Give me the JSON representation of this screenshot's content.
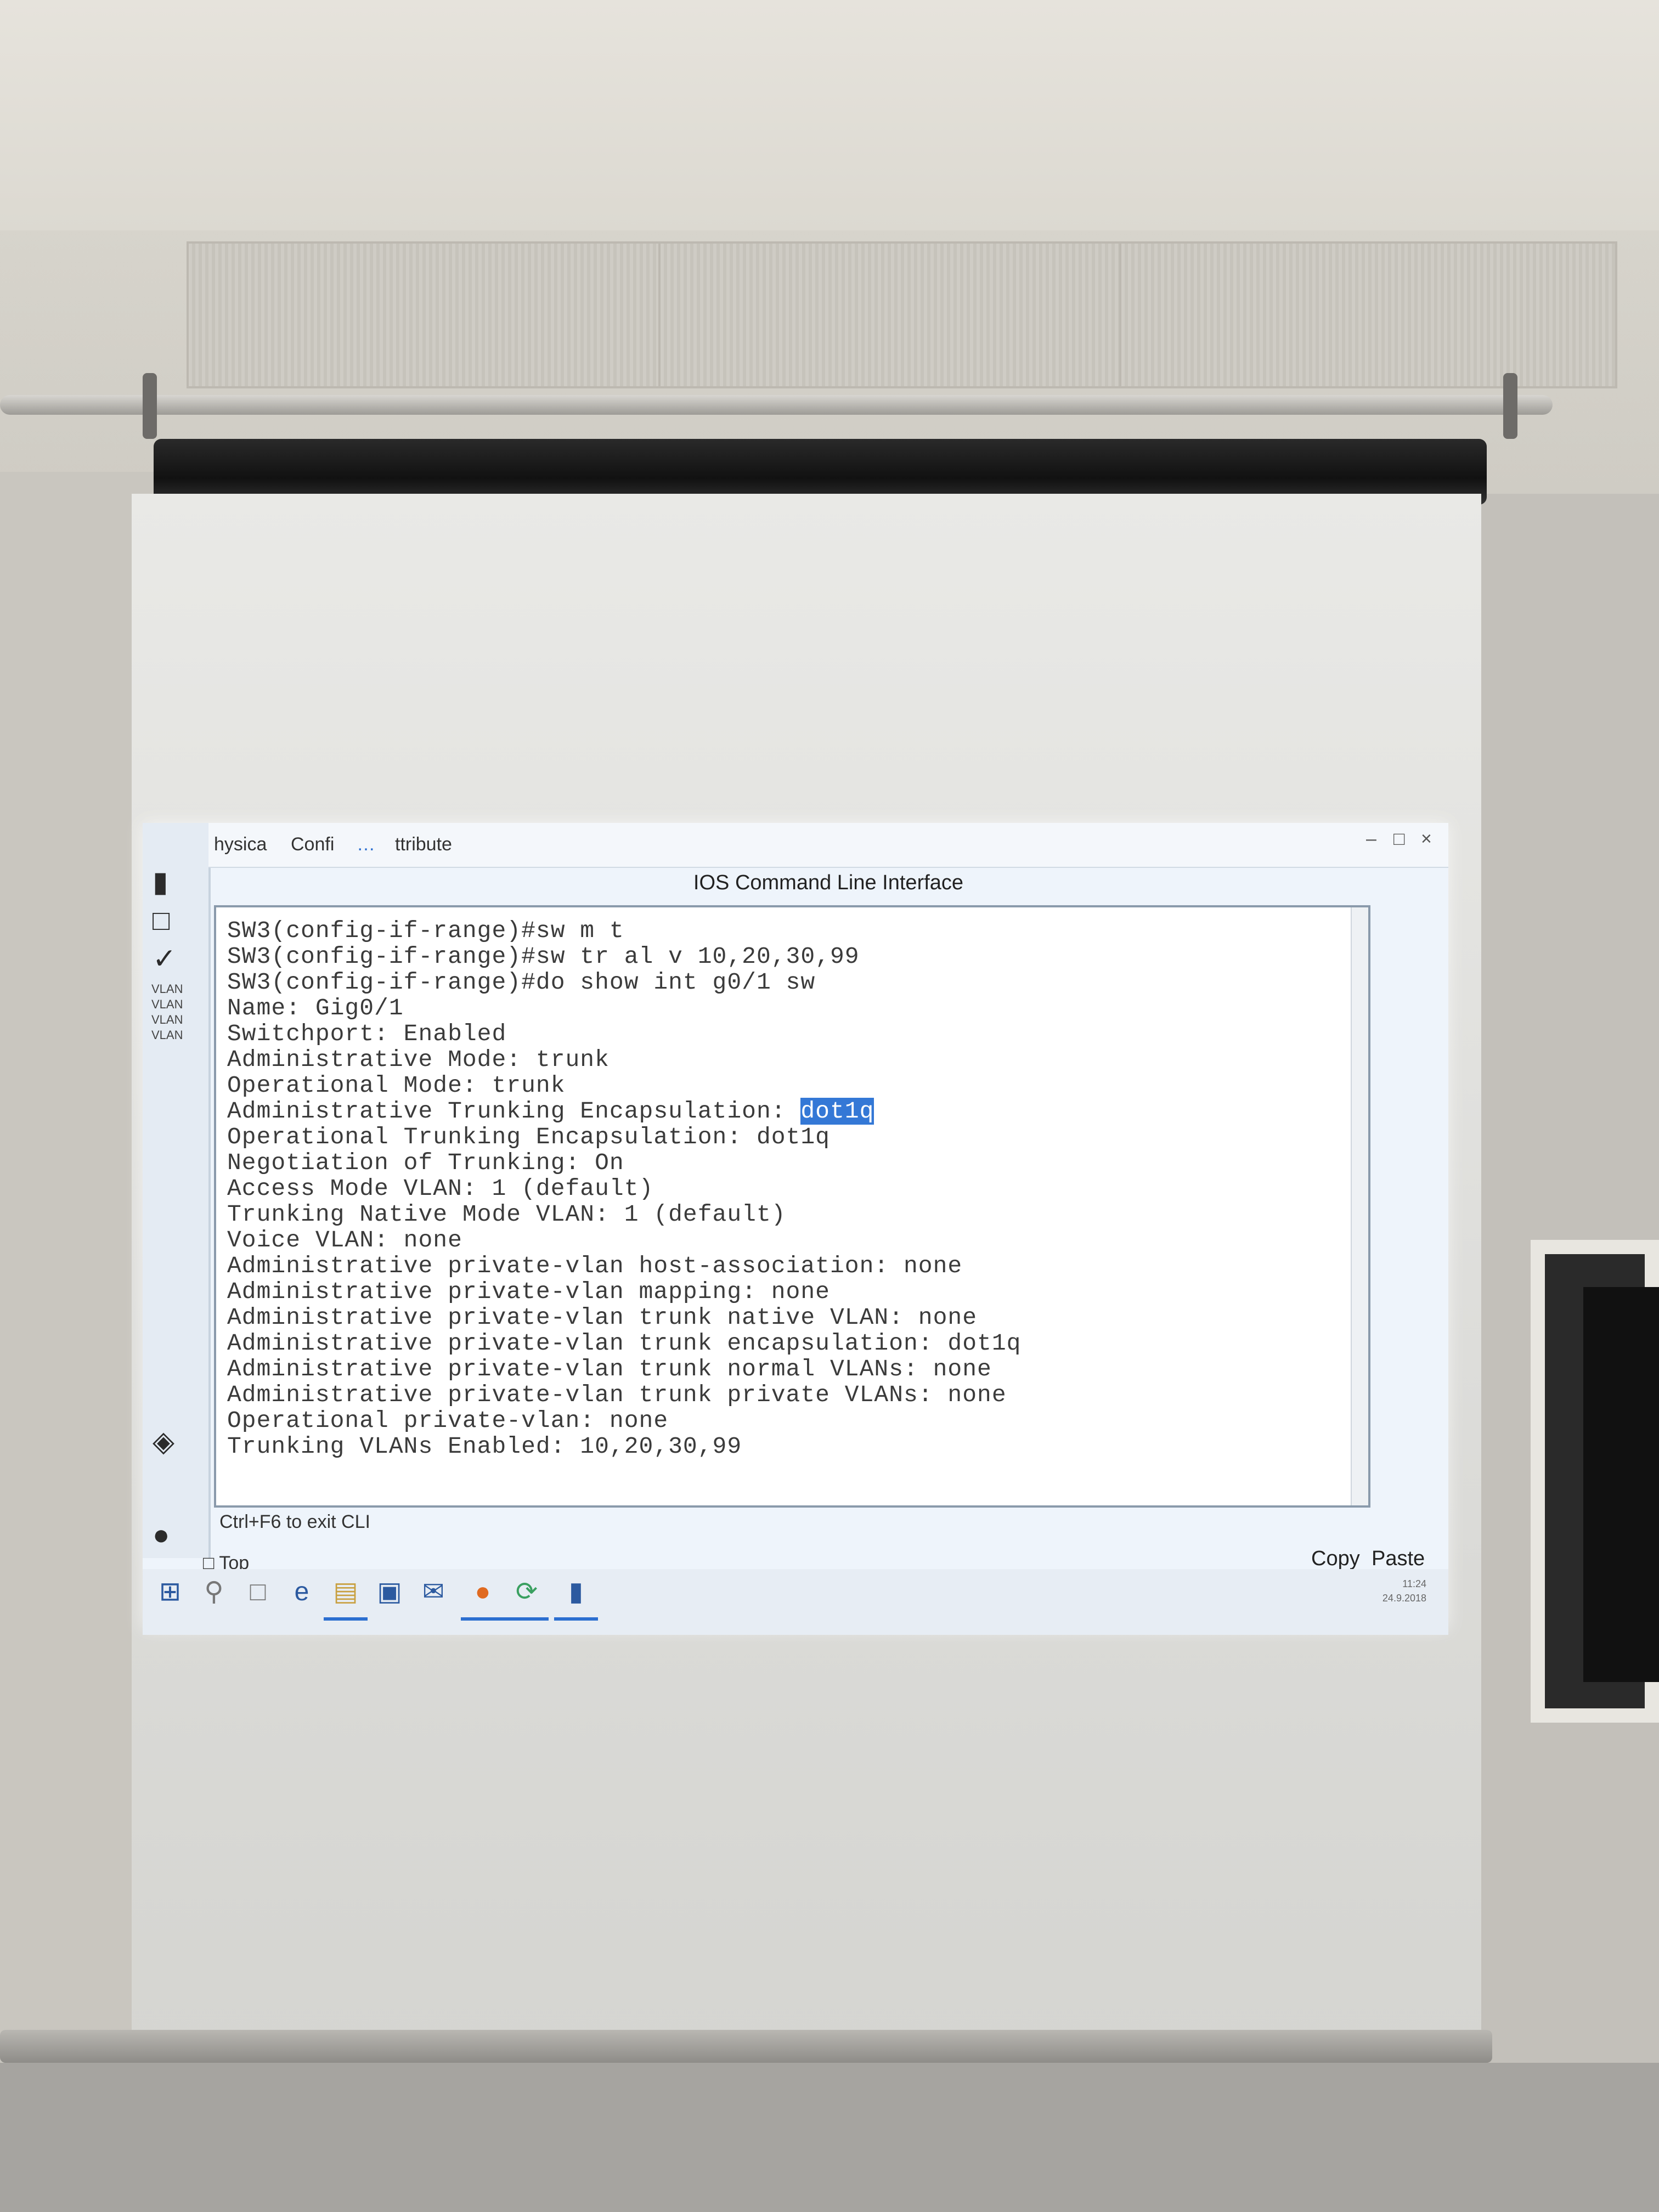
{
  "window": {
    "tabs": [
      "hysica",
      "Confi",
      "…",
      "ttribute"
    ],
    "controls": [
      "–",
      "□",
      "×"
    ]
  },
  "cli": {
    "title": "IOS Command Line Interface",
    "lines": [
      "SW3(config-if-range)#sw m t",
      "SW3(config-if-range)#sw tr al v 10,20,30,99",
      "SW3(config-if-range)#do show int g0/1 sw",
      "Name: Gig0/1",
      "Switchport: Enabled",
      "Administrative Mode: trunk",
      "Operational Mode: trunk",
      "Administrative Trunking Encapsulation: ",
      "Operational Trunking Encapsulation: dot1q",
      "Negotiation of Trunking: On",
      "Access Mode VLAN: 1 (default)",
      "Trunking Native Mode VLAN: 1 (default)",
      "Voice VLAN: none",
      "Administrative private-vlan host-association: none",
      "Administrative private-vlan mapping: none",
      "Administrative private-vlan trunk native VLAN: none",
      "Administrative private-vlan trunk encapsulation: dot1q",
      "Administrative private-vlan trunk normal VLANs: none",
      "Administrative private-vlan trunk private VLANs: none",
      "Operational private-vlan: none",
      "Trunking VLANs Enabled: 10,20,30,99"
    ],
    "selected_text": "dot1q",
    "hint": "Ctrl+F6 to exit CLI"
  },
  "sidebar": {
    "vlan_labels": [
      "VLAN",
      "VLAN",
      "VLAN",
      "VLAN"
    ]
  },
  "footer": {
    "top_checkbox": "Top",
    "copy_label": "Copy",
    "paste_label": "Paste"
  },
  "taskbar": {
    "clock_time": "11:24",
    "clock_date": "24.9.2018"
  }
}
